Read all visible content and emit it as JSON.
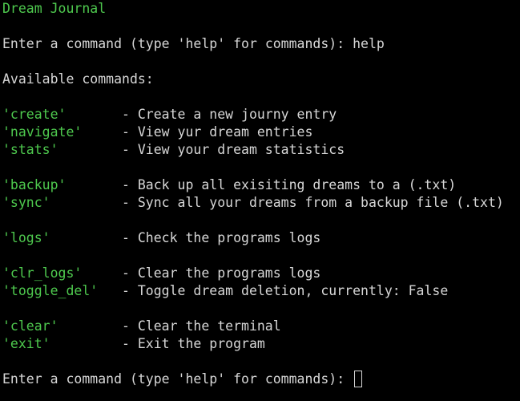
{
  "title": "Dream Journal",
  "prompt_text": "Enter a command (type 'help' for commands): ",
  "first_input": "help",
  "available_header": "Available commands:",
  "commands": [
    {
      "name": "'create'",
      "desc": "- Create a new journy entry"
    },
    {
      "name": "'navigate'",
      "desc": "- View yur dream entries"
    },
    {
      "name": "'stats'",
      "desc": "- View your dream statistics"
    },
    {
      "name": "'backup'",
      "desc": "- Back up all exisiting dreams to a (.txt)"
    },
    {
      "name": "'sync'",
      "desc": "- Sync all your dreams from a backup file (.txt)"
    },
    {
      "name": "'logs'",
      "desc": "- Check the programs logs"
    },
    {
      "name": "'clr_logs'",
      "desc": "- Clear the programs logs"
    },
    {
      "name": "'toggle_del'",
      "desc": "- Toggle dream deletion, currently: False"
    },
    {
      "name": "'clear'",
      "desc": "- Clear the terminal"
    },
    {
      "name": "'exit'",
      "desc": "- Exit the program"
    }
  ],
  "second_prompt_text": "Enter a command (type 'help' for commands): ",
  "colors": {
    "background": "#000000",
    "text": "#d7d7d7",
    "accent_green": "#4ec94e"
  }
}
